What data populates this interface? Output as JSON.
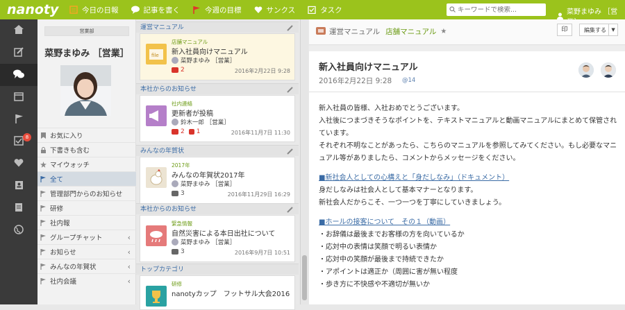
{
  "app": {
    "logo": "nanoty"
  },
  "topnav": [
    {
      "label": "今日の日報",
      "icon": "daily-report-icon"
    },
    {
      "label": "記事を書く",
      "icon": "write-article-icon"
    },
    {
      "label": "今週の目標",
      "icon": "weekly-goal-flag-icon"
    },
    {
      "label": "サンクス",
      "icon": "thanks-heart-icon"
    },
    {
      "label": "タスク",
      "icon": "task-icon"
    }
  ],
  "search": {
    "placeholder": "キーワードで検索..."
  },
  "user": {
    "name": "菜野まゆみ ［営業］"
  },
  "rail": {
    "badge": "8"
  },
  "profile": {
    "department": "営業部",
    "name": "菜野まゆみ ［営業］"
  },
  "menu": [
    {
      "label": "お気に入り",
      "icon": "bookmark-icon"
    },
    {
      "label": "下書きも含む",
      "icon": "lock-icon"
    },
    {
      "label": "マイウォッチ",
      "icon": "star-icon"
    },
    {
      "label": "全て",
      "icon": "flag-icon",
      "active": true
    },
    {
      "label": "管理部門からのお知らせ",
      "icon": "flag-icon"
    },
    {
      "label": "研修",
      "icon": "flag-icon"
    },
    {
      "label": "社内報",
      "icon": "flag-icon"
    },
    {
      "label": "グループチャット",
      "icon": "flag-icon",
      "chevron": true
    },
    {
      "label": "お知らせ",
      "icon": "flag-icon",
      "chevron": true
    },
    {
      "label": "みんなの年賀状",
      "icon": "flag-icon",
      "chevron": true
    },
    {
      "label": "社内会議",
      "icon": "flag-icon",
      "chevron": true
    }
  ],
  "sections": [
    {
      "header": "運営マニュアル",
      "card": {
        "category": "店舗マニュアル",
        "title": "新入社員向けマニュアル",
        "author": "菜野まゆみ ［営業］",
        "comments": "2",
        "likes": "",
        "date": "2016年2月22日 9:28"
      }
    },
    {
      "header": "本社からのお知らせ",
      "card": {
        "category": "社内連絡",
        "title": "更新者が投稿",
        "author": "鈴木一郎 ［営業］",
        "comments": "2",
        "likes": "1",
        "date": "2016年11月7日 11:30"
      }
    },
    {
      "header": "みんなの年賀状",
      "card": {
        "category": "2017年",
        "title": "みんなの年賀状2017年",
        "author": "菜野まゆみ ［営業］",
        "comments": "3",
        "likes": "",
        "date": "2016年11月29日 16:29"
      }
    },
    {
      "header": "本社からのお知らせ",
      "card": {
        "category": "緊急情報",
        "title": "自然災害による本日出社について",
        "author": "菜野まゆみ ［営業］",
        "comments": "3",
        "likes": "",
        "date": "2016年9月7日 10:51"
      }
    },
    {
      "header": "トップカテゴリ",
      "card": {
        "category": "研修",
        "title": "nanotyカップ　フットサル大会2016",
        "author": "",
        "comments": "",
        "likes": "",
        "date": ""
      }
    }
  ],
  "detail": {
    "category": "運営マニュアル",
    "subcategory": "店舗マニュアル",
    "star": "★",
    "print_label": "印",
    "edit_label": "編集する",
    "title": "新入社員向けマニュアル",
    "date": "2016年2月22日 9:28",
    "id": "@14",
    "body": [
      "新入社員の皆様、入社おめでとうございます。",
      "入社後につまづきそうなポイントを、テキストマニュアルと動画マニュアルにまとめて保管されています。",
      "それぞれ不明なことがあったら、こちらのマニュアルを参照してみてください。もし必要なマニュアル等がありましたら、コメントからメッセージをください。",
      "■新社会人としての心構えと「身だしなみ」（ドキュメント）",
      "身だしなみは社会人として基本マナーとなります。",
      "新社会人だからこそ、一つ一つを丁寧にしていきましょう。",
      "■ホールの接客について　その１（動画）",
      "・お辞儀は最後までお客様の方を向いているか",
      "・応対中の表情は笑顔で明るい表情か",
      "・応対中の笑顔が最後まで持続できたか",
      "・アポイントは適正か（周囲に害が無い程度",
      "・歩き方に不快感や不適切が無いか"
    ]
  },
  "colors": {
    "brand": "#9bc31c",
    "link": "#3a6ba5",
    "accent_red": "#d9342b"
  }
}
